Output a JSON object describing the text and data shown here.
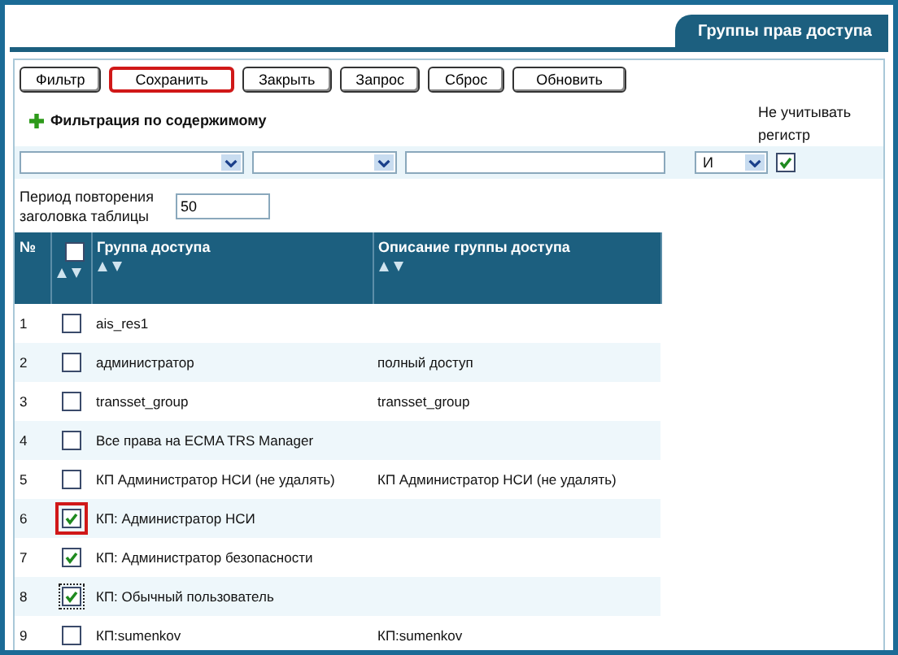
{
  "title": "Группы прав доступа",
  "toolbar": [
    {
      "label": "Фильтр",
      "highlighted": false
    },
    {
      "label": "Сохранить",
      "highlighted": true
    },
    {
      "label": "Закрыть",
      "highlighted": false
    },
    {
      "label": "Запрос",
      "highlighted": false
    },
    {
      "label": "Сброс",
      "highlighted": false
    },
    {
      "label": "Обновить",
      "highlighted": false
    }
  ],
  "filter": {
    "heading": "Фильтрация по содержимому",
    "case_label": "Не учитывать регистр",
    "operator": "И",
    "ignore_case": true
  },
  "header_period": {
    "label": "Период повторения заголовка таблицы",
    "value": "50"
  },
  "table": {
    "columns": [
      "№",
      "Группа доступа",
      "Описание группы доступа"
    ],
    "select_all_checked": false,
    "rows": [
      {
        "num": "1",
        "checked": false,
        "highlighted": false,
        "focused": false,
        "group": "ais_res1",
        "description": ""
      },
      {
        "num": "2",
        "checked": false,
        "highlighted": false,
        "focused": false,
        "group": "администратор",
        "description": "полный доступ"
      },
      {
        "num": "3",
        "checked": false,
        "highlighted": false,
        "focused": false,
        "group": "transset_group",
        "description": "transset_group"
      },
      {
        "num": "4",
        "checked": false,
        "highlighted": false,
        "focused": false,
        "group": "Все права на ECMA TRS Manager",
        "description": ""
      },
      {
        "num": "5",
        "checked": false,
        "highlighted": false,
        "focused": false,
        "group": "КП Администратор НСИ (не удалять)",
        "description": "КП Администратор НСИ (не удалять)"
      },
      {
        "num": "6",
        "checked": true,
        "highlighted": true,
        "focused": false,
        "group": "КП: Администратор НСИ",
        "description": ""
      },
      {
        "num": "7",
        "checked": true,
        "highlighted": false,
        "focused": false,
        "group": "КП: Администратор безопасности",
        "description": ""
      },
      {
        "num": "8",
        "checked": true,
        "highlighted": false,
        "focused": true,
        "group": "КП: Обычный пользователь",
        "description": ""
      },
      {
        "num": "9",
        "checked": false,
        "highlighted": false,
        "focused": false,
        "group": "КП:sumenkov",
        "description": "КП:sumenkov"
      }
    ]
  }
}
